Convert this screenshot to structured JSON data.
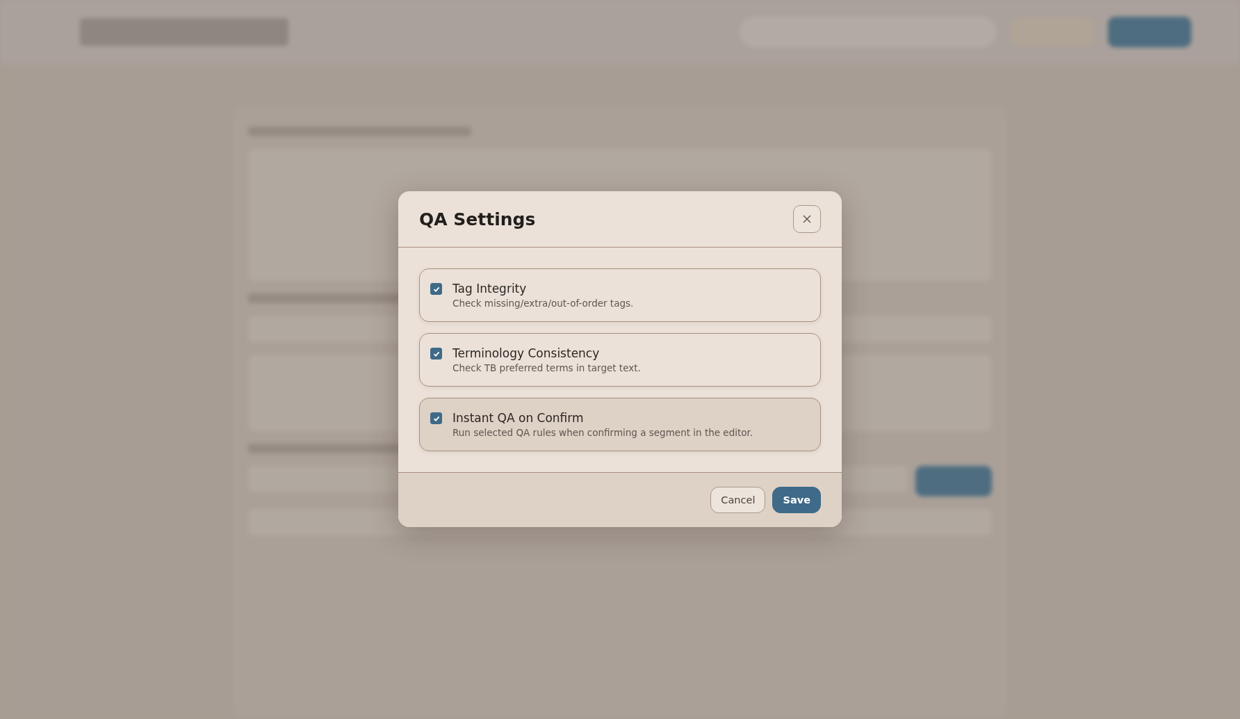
{
  "dialog": {
    "title": "QA Settings",
    "options": [
      {
        "label": "Tag Integrity",
        "description": "Check missing/extra/out-of-order tags.",
        "checked": true,
        "highlighted": false
      },
      {
        "label": "Terminology Consistency",
        "description": "Check TB preferred terms in target text.",
        "checked": true,
        "highlighted": false
      },
      {
        "label": "Instant QA on Confirm",
        "description": "Run selected QA rules when confirming a segment in the editor.",
        "checked": true,
        "highlighted": true
      }
    ],
    "buttons": [
      {
        "label": "Cancel",
        "kind": "secondary"
      },
      {
        "label": "Save",
        "kind": "primary"
      }
    ]
  }
}
